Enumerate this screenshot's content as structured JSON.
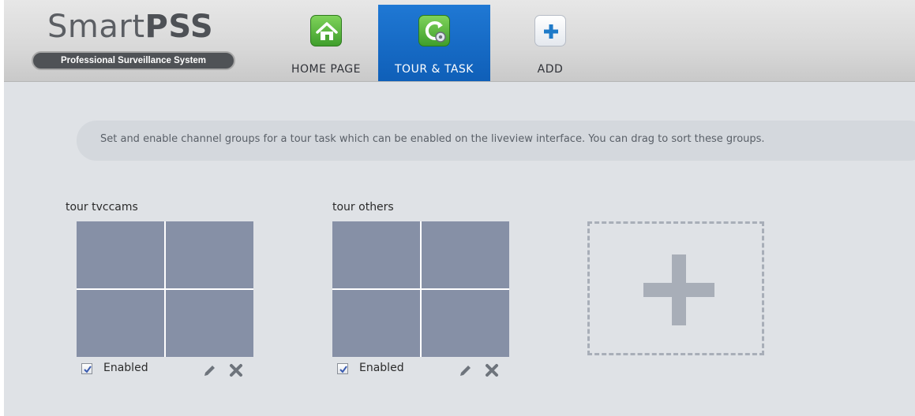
{
  "app": {
    "name_regular": "Smart",
    "name_bold": "PSS",
    "subtitle": "Professional Surveillance System"
  },
  "nav": {
    "tabs": [
      {
        "label": "HOME PAGE",
        "icon": "home-icon",
        "active": false
      },
      {
        "label": "TOUR & TASK",
        "icon": "tour-task-icon",
        "active": true
      },
      {
        "label": "ADD",
        "icon": "add-icon",
        "active": false
      }
    ]
  },
  "description": "Set and enable channel groups for a tour task which can be enabled on the liveview interface. You can drag to sort these groups.",
  "groups": [
    {
      "title": "tour tvccams",
      "enabled_label": "Enabled",
      "enabled": true
    },
    {
      "title": "tour others",
      "enabled_label": "Enabled",
      "enabled": true
    }
  ],
  "colors": {
    "active_tab": "#1f78d4",
    "cell": "#8690a6",
    "background": "#dfe2e6",
    "add_box_border": "#a8aeb8"
  }
}
